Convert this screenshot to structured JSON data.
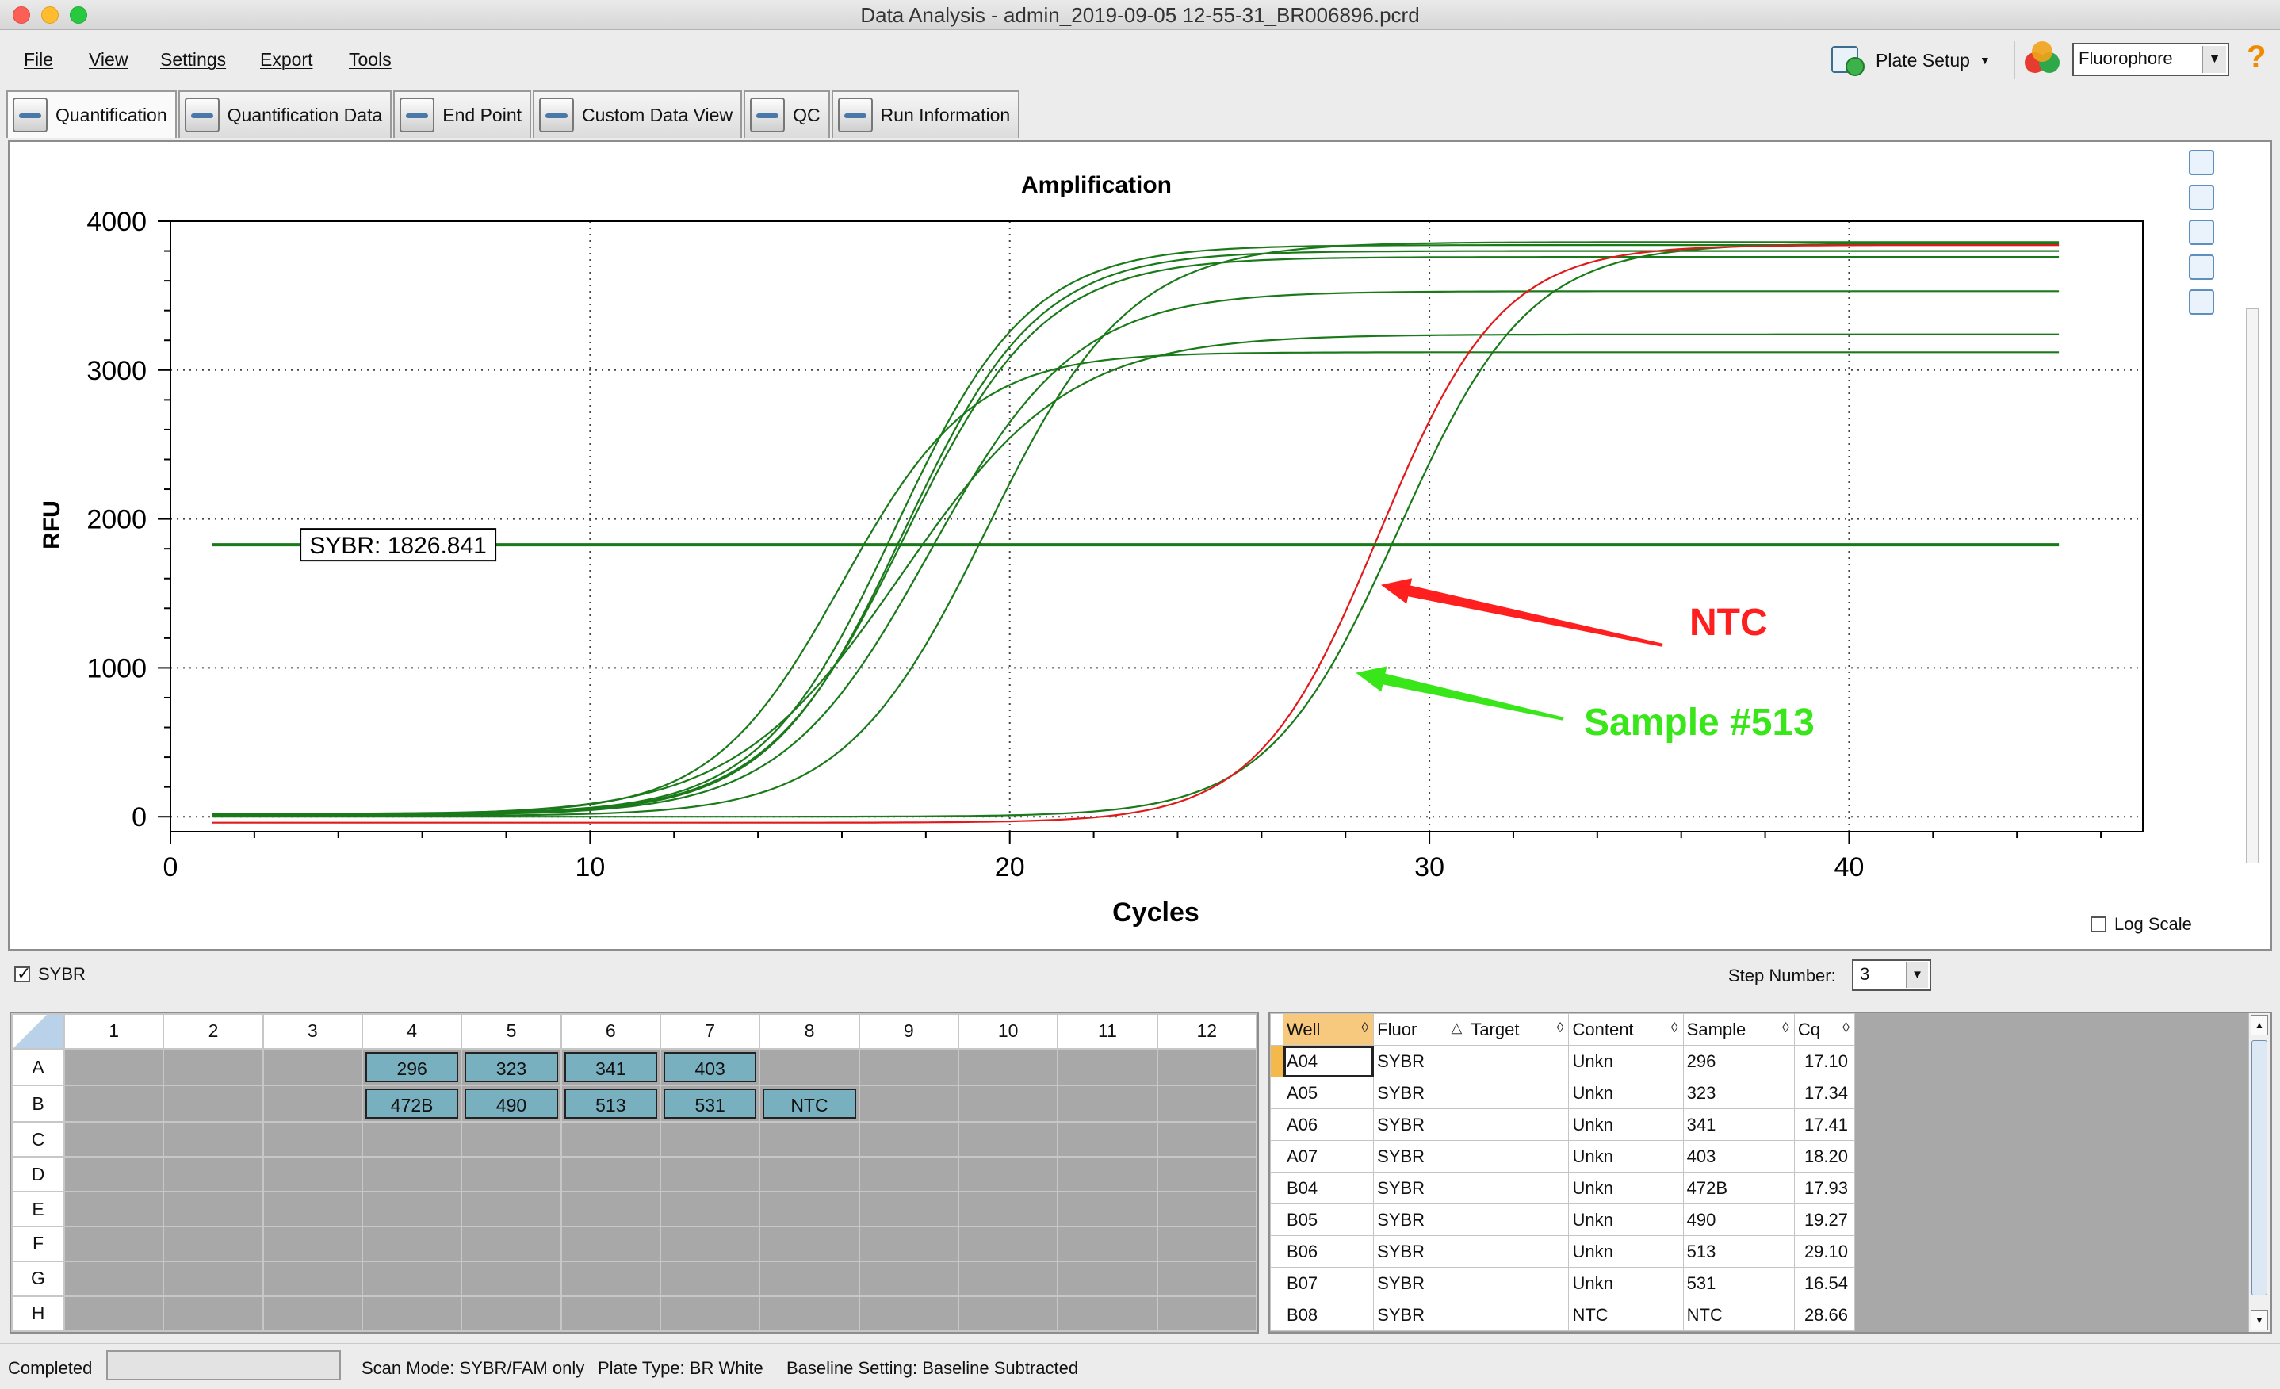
{
  "window": {
    "title": "Data Analysis - admin_2019-09-05 12-55-31_BR006896.pcrd"
  },
  "menu": [
    "File",
    "View",
    "Settings",
    "Export",
    "Tools"
  ],
  "toolbar": {
    "plate_setup": "Plate Setup",
    "fluorophore": "Fluorophore",
    "help_icon": "?"
  },
  "tabs": [
    {
      "label": "Quantification",
      "icon": "amplification-icon"
    },
    {
      "label": "Quantification Data",
      "icon": "quant-data-icon"
    },
    {
      "label": "End Point",
      "icon": "end-point-icon"
    },
    {
      "label": "Custom Data View",
      "icon": "gear-icon"
    },
    {
      "label": "QC",
      "icon": "qc-icon"
    },
    {
      "label": "Run Information",
      "icon": "run-info-icon"
    }
  ],
  "chart_options": {
    "log_scale_label": "Log Scale",
    "log_scale_checked": false,
    "sybr_label": "SYBR",
    "sybr_checked": true,
    "step_label": "Step Number:",
    "step_value": "3"
  },
  "chart_data": {
    "type": "line",
    "title": "Amplification",
    "xlabel": "Cycles",
    "ylabel": "RFU",
    "xlim": [
      0,
      47
    ],
    "ylim": [
      -100,
      4000
    ],
    "xticks": [
      0,
      10,
      20,
      30,
      40
    ],
    "yticks": [
      0,
      1000,
      2000,
      3000,
      4000
    ],
    "grid": true,
    "threshold": {
      "label": "SYBR: 1826.841",
      "value": 1826.841,
      "color": "#1a7a1a"
    },
    "series": [
      {
        "well": "A04",
        "color": "#1a7a1a",
        "cq": 17.1,
        "plateau": 3840,
        "slope": 1.6,
        "start": 20
      },
      {
        "well": "A05",
        "color": "#1a7a1a",
        "cq": 17.34,
        "plateau": 3800,
        "slope": 1.6,
        "start": 15
      },
      {
        "well": "A06",
        "color": "#1a7a1a",
        "cq": 17.41,
        "plateau": 3760,
        "slope": 1.65,
        "start": 15
      },
      {
        "well": "A07",
        "color": "#1a7a1a",
        "cq": 18.2,
        "plateau": 3530,
        "slope": 1.75,
        "start": 10
      },
      {
        "well": "B04",
        "color": "#1a7a1a",
        "cq": 17.93,
        "plateau": 3240,
        "slope": 2.0,
        "start": 10
      },
      {
        "well": "B05",
        "color": "#1a7a1a",
        "cq": 19.27,
        "plateau": 3860,
        "slope": 1.7,
        "start": 5
      },
      {
        "well": "B06",
        "color": "#1a7a1a",
        "cq": 29.1,
        "plateau": 3850,
        "slope": 1.55,
        "start": 0
      },
      {
        "well": "B07",
        "color": "#1a7a1a",
        "cq": 16.54,
        "plateau": 3120,
        "slope": 1.55,
        "start": 20
      },
      {
        "well": "B08",
        "color": "#e01a1a",
        "cq": 28.66,
        "plateau": 3840,
        "slope": 1.45,
        "start": -40
      }
    ],
    "annotations": [
      {
        "text": "NTC",
        "color": "#ff1f1f",
        "cycle": 28.8,
        "rfu": 1560
      },
      {
        "text": "Sample #513",
        "color": "#39e61a",
        "cycle": 28.2,
        "rfu": 970
      }
    ]
  },
  "plate": {
    "columns": [
      "1",
      "2",
      "3",
      "4",
      "5",
      "6",
      "7",
      "8",
      "9",
      "10",
      "11",
      "12"
    ],
    "rows": [
      {
        "label": "A",
        "wells": [
          "",
          "",
          "",
          "296",
          "323",
          "341",
          "403",
          "",
          "",
          "",
          "",
          ""
        ]
      },
      {
        "label": "B",
        "wells": [
          "",
          "",
          "",
          "472B",
          "490",
          "513",
          "531",
          "NTC",
          "",
          "",
          "",
          ""
        ]
      },
      {
        "label": "C",
        "wells": [
          "",
          "",
          "",
          "",
          "",
          "",
          "",
          "",
          "",
          "",
          "",
          ""
        ]
      },
      {
        "label": "D",
        "wells": [
          "",
          "",
          "",
          "",
          "",
          "",
          "",
          "",
          "",
          "",
          "",
          ""
        ]
      },
      {
        "label": "E",
        "wells": [
          "",
          "",
          "",
          "",
          "",
          "",
          "",
          "",
          "",
          "",
          "",
          ""
        ]
      },
      {
        "label": "F",
        "wells": [
          "",
          "",
          "",
          "",
          "",
          "",
          "",
          "",
          "",
          "",
          "",
          ""
        ]
      },
      {
        "label": "G",
        "wells": [
          "",
          "",
          "",
          "",
          "",
          "",
          "",
          "",
          "",
          "",
          "",
          ""
        ]
      },
      {
        "label": "H",
        "wells": [
          "",
          "",
          "",
          "",
          "",
          "",
          "",
          "",
          "",
          "",
          "",
          ""
        ]
      }
    ]
  },
  "results": {
    "headers": [
      "Well",
      "Fluor",
      "Target",
      "Content",
      "Sample",
      "Cq"
    ],
    "rows": [
      [
        "A04",
        "SYBR",
        "",
        "Unkn",
        "296",
        "17.10"
      ],
      [
        "A05",
        "SYBR",
        "",
        "Unkn",
        "323",
        "17.34"
      ],
      [
        "A06",
        "SYBR",
        "",
        "Unkn",
        "341",
        "17.41"
      ],
      [
        "A07",
        "SYBR",
        "",
        "Unkn",
        "403",
        "18.20"
      ],
      [
        "B04",
        "SYBR",
        "",
        "Unkn",
        "472B",
        "17.93"
      ],
      [
        "B05",
        "SYBR",
        "",
        "Unkn",
        "490",
        "19.27"
      ],
      [
        "B06",
        "SYBR",
        "",
        "Unkn",
        "513",
        "29.10"
      ],
      [
        "B07",
        "SYBR",
        "",
        "Unkn",
        "531",
        "16.54"
      ],
      [
        "B08",
        "SYBR",
        "",
        "NTC",
        "NTC",
        "28.66"
      ]
    ]
  },
  "status": {
    "state": "Completed",
    "scan_mode": "Scan Mode: SYBR/FAM only",
    "plate_type": "Plate Type: BR White",
    "baseline": "Baseline Setting: Baseline Subtracted"
  }
}
